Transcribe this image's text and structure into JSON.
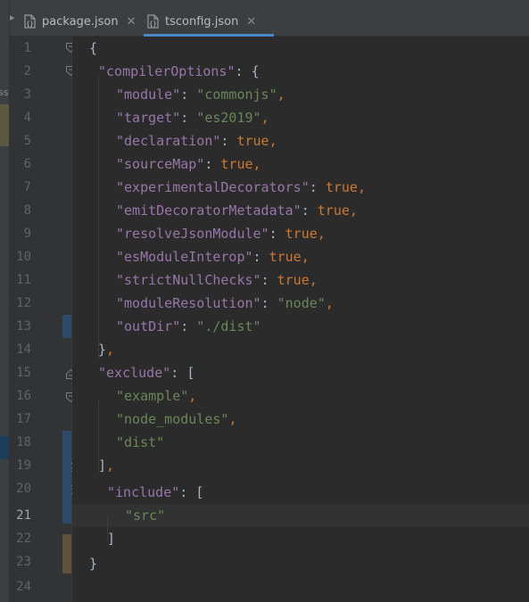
{
  "sidebar": {
    "clipped_text": "ss"
  },
  "tabs": [
    {
      "label": "package.json",
      "active": false,
      "close": "✕"
    },
    {
      "label": "tsconfig.json",
      "active": true,
      "close": "✕"
    }
  ],
  "editor": {
    "line_numbers": [
      "1",
      "2",
      "3",
      "4",
      "5",
      "6",
      "7",
      "8",
      "9",
      "10",
      "11",
      "12",
      "13",
      "14",
      "15",
      "16",
      "17",
      "18",
      "19",
      "20",
      "21",
      "22",
      "23",
      "24"
    ],
    "current_line": 21,
    "lines": {
      "l1": {
        "brace": "{"
      },
      "l2": {
        "key": "\"compilerOptions\"",
        "colon": ":",
        "brace": " {"
      },
      "l3": {
        "key": "\"module\"",
        "colon": ": ",
        "value": "\"commonjs\"",
        "comma": ","
      },
      "l4": {
        "key": "\"target\"",
        "colon": ": ",
        "value": "\"es2019\"",
        "comma": ","
      },
      "l5": {
        "key": "\"declaration\"",
        "colon": ": ",
        "value": "true",
        "comma": ","
      },
      "l6": {
        "key": "\"sourceMap\"",
        "colon": ": ",
        "value": "true",
        "comma": ","
      },
      "l7": {
        "key": "\"experimentalDecorators\"",
        "colon": ": ",
        "value": "true",
        "comma": ","
      },
      "l8": {
        "key": "\"emitDecoratorMetadata\"",
        "colon": ": ",
        "value": "true",
        "comma": ","
      },
      "l9": {
        "key": "\"resolveJsonModule\"",
        "colon": ": ",
        "value": "true",
        "comma": ","
      },
      "l10": {
        "key": "\"esModuleInterop\"",
        "colon": ": ",
        "value": "true",
        "comma": ","
      },
      "l11": {
        "key": "\"strictNullChecks\"",
        "colon": ": ",
        "value": "true",
        "comma": ","
      },
      "l12": {
        "key": "\"moduleResolution\"",
        "colon": ": ",
        "value": "\"node\"",
        "comma": ","
      },
      "l13": {
        "key": "\"outDir\"",
        "colon": ": ",
        "value": "\"./dist\""
      },
      "l14": {
        "brace": "}",
        "comma": ","
      },
      "l15": {
        "key": "\"exclude\"",
        "colon": ": ",
        "bracket": "["
      },
      "l16": {
        "value": "\"example\"",
        "comma": ","
      },
      "l17": {
        "value": "\"node_modules\"",
        "comma": ","
      },
      "l18": {
        "value": "\"dist\""
      },
      "l19": {
        "bracket": "]",
        "comma": ","
      },
      "l20": {
        "key": "\"include\"",
        "colon": ": ",
        "bracket": "["
      },
      "l21": {
        "value": "\"src\""
      },
      "l22": {
        "bracket": "]"
      },
      "l23": {
        "brace": "}"
      }
    }
  },
  "colors": {
    "background": "#2b2b2b",
    "key": "#9876aa",
    "string": "#6a8759",
    "keyword": "#cc7832",
    "punctuation": "#a9b7c6",
    "tab_underline": "#4a88c7"
  },
  "icons": {
    "file_icon": "json-file-icon",
    "fold_icon": "fold-marker-icon"
  }
}
